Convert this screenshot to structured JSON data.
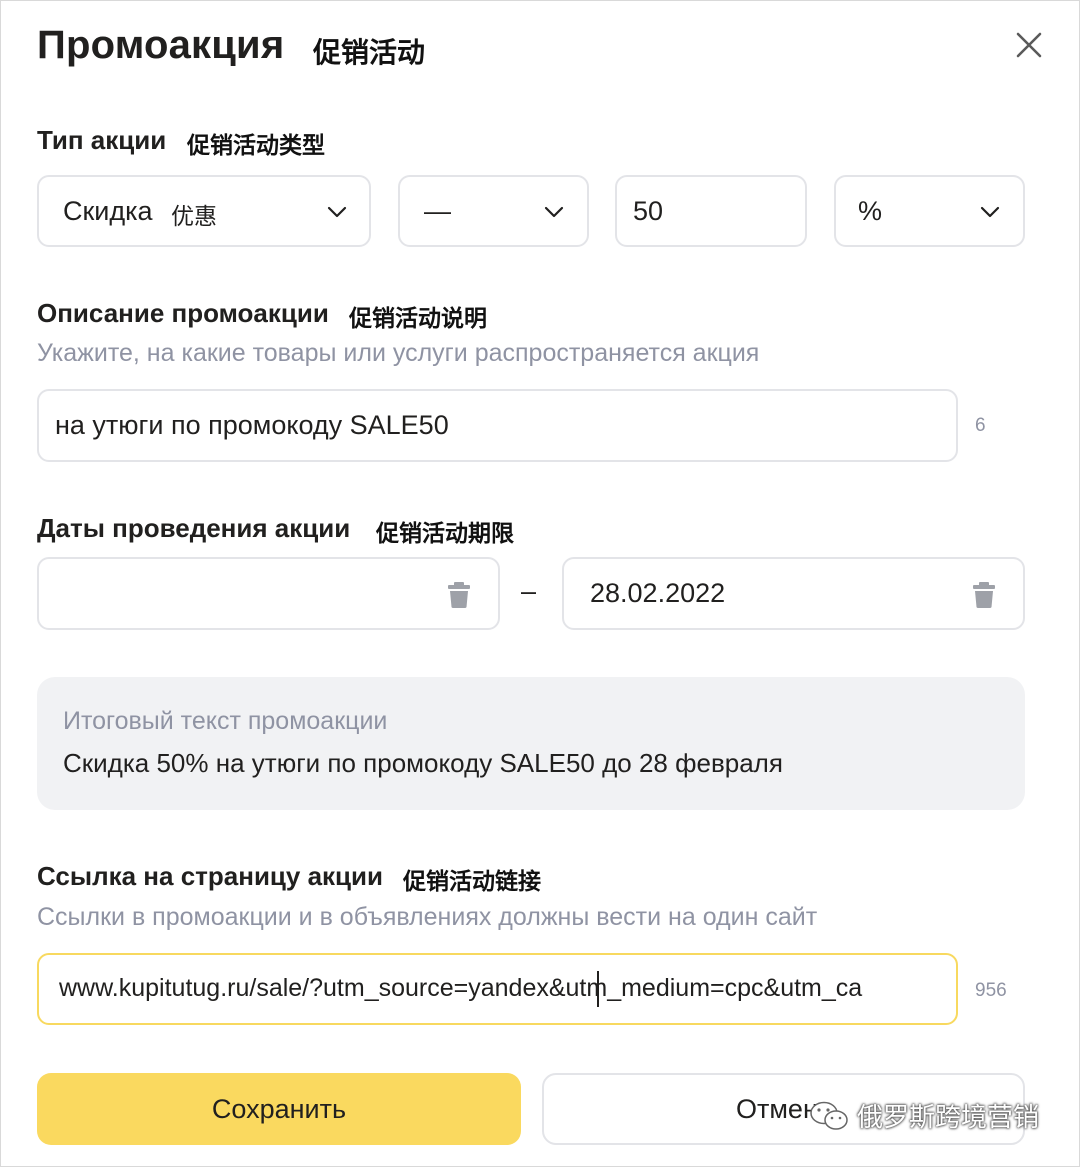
{
  "dialog": {
    "title": "Промоакция",
    "title_cn": "促销活动"
  },
  "promo_type": {
    "label": "Тип акции",
    "label_cn": "促销活动类型",
    "type_value": "Скидка",
    "type_value_cn": "优惠",
    "modifier_value": "—",
    "amount_value": "50",
    "unit_value": "%"
  },
  "description": {
    "label": "Описание промоакции",
    "label_cn": "促销活动说明",
    "hint": "Укажите, на какие товары или услуги распространяется акция",
    "value": "на утюги по промокоду SALE50",
    "counter": "6"
  },
  "dates": {
    "label": "Даты проведения акции",
    "label_cn": "促销活动期限",
    "start_value": "",
    "separator": "–",
    "end_value": "28.02.2022"
  },
  "summary": {
    "label": "Итоговый текст промоакции",
    "text": "Скидка 50% на утюги по промокоду SALE50 до 28 февраля"
  },
  "link": {
    "label": "Ссылка на страницу акции",
    "label_cn": "促销活动链接",
    "hint": "Ссылки в промоакции и в объявлениях должны вести на один сайт",
    "value": "www.kupitutug.ru/sale/?utm_source=yandex&utm_medium=cpc&utm_ca",
    "counter": "956"
  },
  "actions": {
    "save_label": "Сохранить",
    "cancel_label": "Отмена"
  },
  "watermark": {
    "text": "俄罗斯跨境营销"
  },
  "colors": {
    "accent": "#fad95f",
    "active_border": "#f8d95f",
    "summary_bg": "#f1f2f4",
    "hint_text": "#8f93a3"
  },
  "icons": [
    "close-icon",
    "chevron-down-icon",
    "trash-icon",
    "wechat-icon"
  ]
}
